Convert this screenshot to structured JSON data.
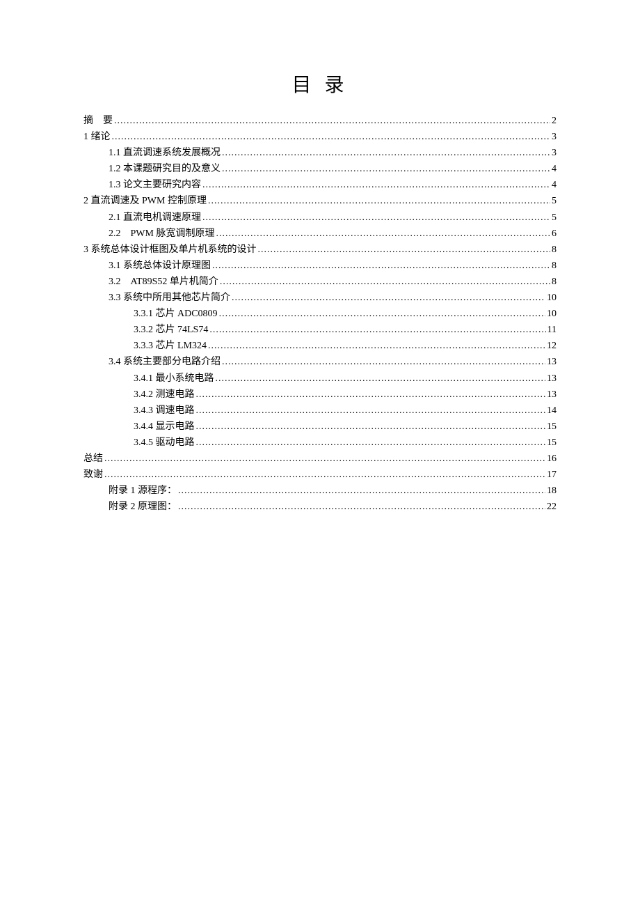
{
  "title": "目 录",
  "toc": [
    {
      "level": 0,
      "label": "摘　要",
      "page": "2"
    },
    {
      "level": 0,
      "label": "1 绪论",
      "page": "3"
    },
    {
      "level": 1,
      "label": "1.1  直流调速系统发展概况",
      "page": "3"
    },
    {
      "level": 1,
      "label": "1.2  本课题研究目的及意义",
      "page": "4"
    },
    {
      "level": 1,
      "label": "1.3  论文主要研究内容",
      "page": "4"
    },
    {
      "level": 0,
      "label": "2  直流调速及 PWM 控制原理",
      "page": "5"
    },
    {
      "level": 1,
      "label": "2.1  直流电机调速原理",
      "page": "5"
    },
    {
      "level": 1,
      "label": "2.2　PWM 脉宽调制原理",
      "page": "6"
    },
    {
      "level": 0,
      "label": "3  系统总体设计框图及单片机系统的设计",
      "page": "8"
    },
    {
      "level": 1,
      "label": "3.1  系统总体设计原理图",
      "page": "8"
    },
    {
      "level": 1,
      "label": "3.2　AT89S52 单片机简介 ",
      "page": "8"
    },
    {
      "level": 1,
      "label": "3.3  系统中所用其他芯片简介",
      "page": "10"
    },
    {
      "level": 2,
      "label": "3.3.1  芯片 ADC0809 ",
      "page": "10"
    },
    {
      "level": 2,
      "label": "3.3.2  芯片 74LS74 ",
      "page": "11"
    },
    {
      "level": 2,
      "label": "3.3.3  芯片 LM324",
      "page": "12"
    },
    {
      "level": 1,
      "label": "3.4  系统主要部分电路介绍",
      "page": "13"
    },
    {
      "level": 2,
      "label": "3.4.1  最小系统电路",
      "page": "13"
    },
    {
      "level": 2,
      "label": "3.4.2  测速电路",
      "page": "13"
    },
    {
      "level": 2,
      "label": "3.4.3  调速电路",
      "page": "14"
    },
    {
      "level": 2,
      "label": "3.4.4  显示电路",
      "page": "15"
    },
    {
      "level": 2,
      "label": "3.4.5  驱动电路",
      "page": "15"
    },
    {
      "level": 0,
      "label": "总结",
      "page": "16"
    },
    {
      "level": 0,
      "label": "致谢",
      "page": "17"
    },
    {
      "level": 1,
      "label": "附录 1 源程序：",
      "page": "18"
    },
    {
      "level": 1,
      "label": "附录 2 原理图：",
      "page": "22"
    }
  ]
}
